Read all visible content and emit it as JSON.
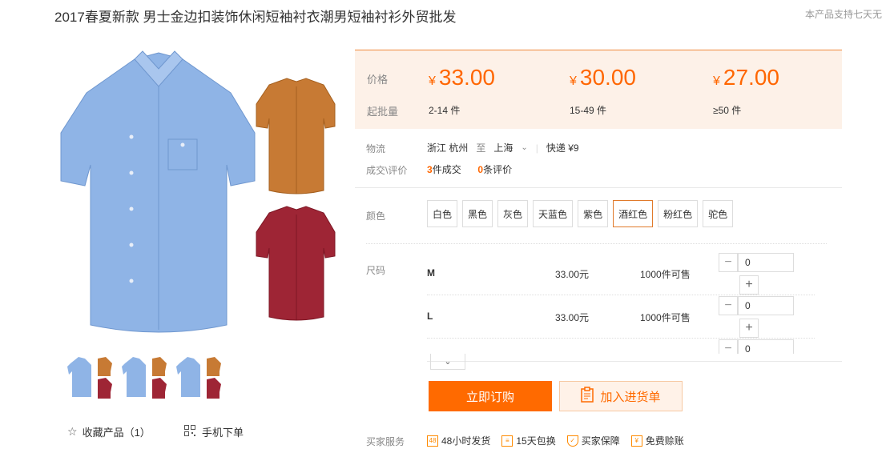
{
  "product": {
    "title": "2017春夏新款 男士金边扣装饰休闲短袖衬衣潮男短袖衬衫外贸批发",
    "support_text": "本产品支持七天无"
  },
  "gallery": {
    "favorite_label": "收藏产品（1）",
    "mobile_order_label": "手机下单",
    "colors": {
      "blue": "#8fb4e6",
      "orange": "#c77a34",
      "red": "#9e2535"
    }
  },
  "pricing": {
    "price_label": "价格",
    "qty_label": "起批量",
    "currency": "¥",
    "tiers": [
      {
        "price": "33.00",
        "qty": "2-14 件"
      },
      {
        "price": "30.00",
        "qty": "15-49 件"
      },
      {
        "price": "27.00",
        "qty": "≥50 件"
      }
    ]
  },
  "logistics": {
    "label": "物流",
    "from": "浙江 杭州",
    "to_word": "至",
    "to": "上海",
    "shipping": "快递 ¥9"
  },
  "deals": {
    "label": "成交\\评价",
    "sold_count": "3",
    "sold_suffix": "件成交",
    "review_count": "0",
    "review_suffix": "条评价"
  },
  "color_option": {
    "label": "颜色",
    "options": [
      "白色",
      "黑色",
      "灰色",
      "天蓝色",
      "紫色",
      "酒红色",
      "粉红色",
      "驼色"
    ],
    "selected": "酒红色"
  },
  "size_option": {
    "label": "尺码",
    "rows": [
      {
        "size": "M",
        "price": "33.00元",
        "stock": "1000件可售",
        "qty": "0"
      },
      {
        "size": "L",
        "price": "33.00元",
        "stock": "1000件可售",
        "qty": "0"
      },
      {
        "size": "",
        "price": "",
        "stock": "",
        "qty": "0"
      }
    ]
  },
  "actions": {
    "buy_label": "立即订购",
    "cart_label": "加入进货单"
  },
  "services": {
    "label": "买家服务",
    "items": [
      "48小时发货",
      "15天包换",
      "买家保障",
      "免费赊账"
    ]
  },
  "accent_color": "#ff6a00"
}
